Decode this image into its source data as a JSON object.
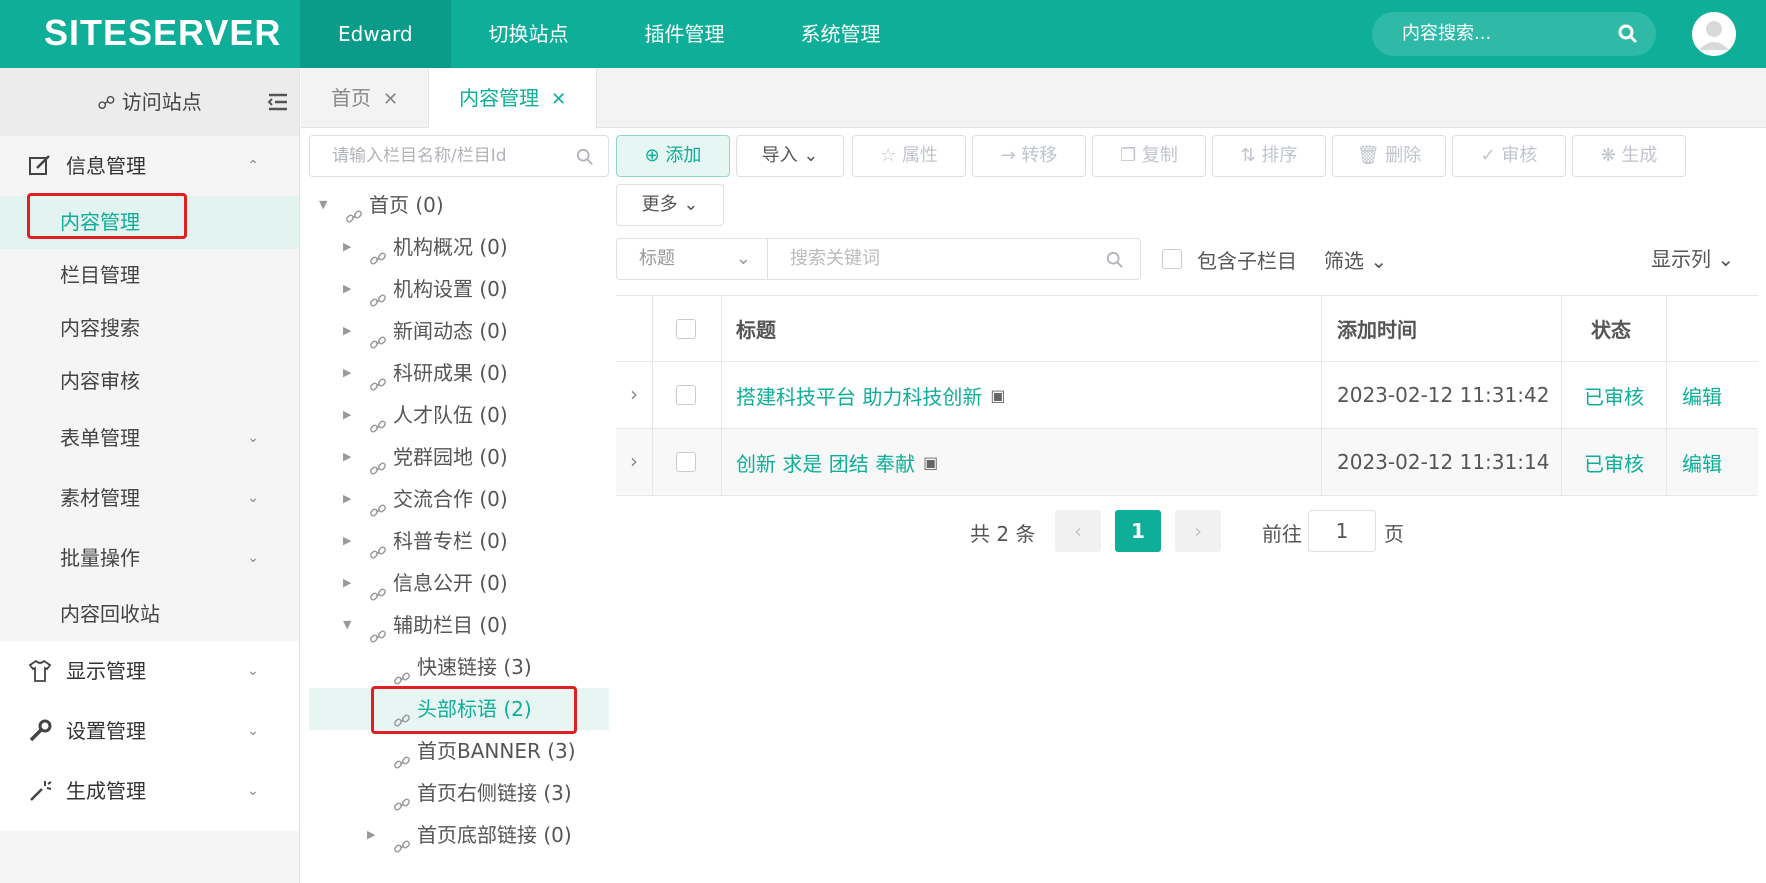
{
  "topbar": {
    "logo": "SITESERVER",
    "nav": [
      "Edward",
      "切换站点",
      "插件管理",
      "系统管理"
    ],
    "search_placeholder": "内容搜索..."
  },
  "sidebar": {
    "visit": "访问站点",
    "groups": [
      {
        "label": "信息管理",
        "icon": "edit-icon"
      },
      {
        "label": "显示管理",
        "icon": "shirt-icon"
      },
      {
        "label": "设置管理",
        "icon": "wrench-icon"
      },
      {
        "label": "生成管理",
        "icon": "magic-wand-icon"
      }
    ],
    "subitems": [
      "内容管理",
      "栏目管理",
      "内容搜索",
      "内容审核",
      "表单管理",
      "素材管理",
      "批量操作",
      "内容回收站"
    ]
  },
  "tabs": [
    {
      "label": "首页"
    },
    {
      "label": "内容管理"
    }
  ],
  "tree": {
    "search_placeholder": "请输入栏目名称/栏目Id",
    "nodes": [
      "首页 (0)",
      "机构概况 (0)",
      "机构设置 (0)",
      "新闻动态 (0)",
      "科研成果 (0)",
      "人才队伍 (0)",
      "党群园地 (0)",
      "交流合作 (0)",
      "科普专栏 (0)",
      "信息公开 (0)",
      "辅助栏目 (0)",
      "快速链接 (3)",
      "头部标语 (2)",
      "首页BANNER (3)",
      "首页右侧链接 (3)",
      "首页底部链接 (0)"
    ]
  },
  "toolbar": {
    "add": "添加",
    "import": "导入",
    "props": "属性",
    "move": "转移",
    "copy": "复制",
    "sort": "排序",
    "delete": "删除",
    "audit": "审核",
    "generate": "生成",
    "more": "更多"
  },
  "filter": {
    "field": "标题",
    "keyword_placeholder": "搜索关键词",
    "include_children": "包含子栏目",
    "filter": "筛选",
    "columns": "显示列"
  },
  "table": {
    "headers": {
      "title": "标题",
      "time": "添加时间",
      "status": "状态"
    },
    "rows": [
      {
        "title": "搭建科技平台 助力科技创新",
        "time": "2023-02-12 11:31:42",
        "status": "已审核",
        "action": "编辑"
      },
      {
        "title": "创新 求是 团结 奉献",
        "time": "2023-02-12 11:31:14",
        "status": "已审核",
        "action": "编辑"
      }
    ]
  },
  "pager": {
    "total": "共 2 条",
    "current": "1",
    "goto": "前往",
    "page_input": "1",
    "page_unit": "页"
  },
  "colors": {
    "accent": "#0fae99",
    "highlight_box": "#e02020"
  }
}
